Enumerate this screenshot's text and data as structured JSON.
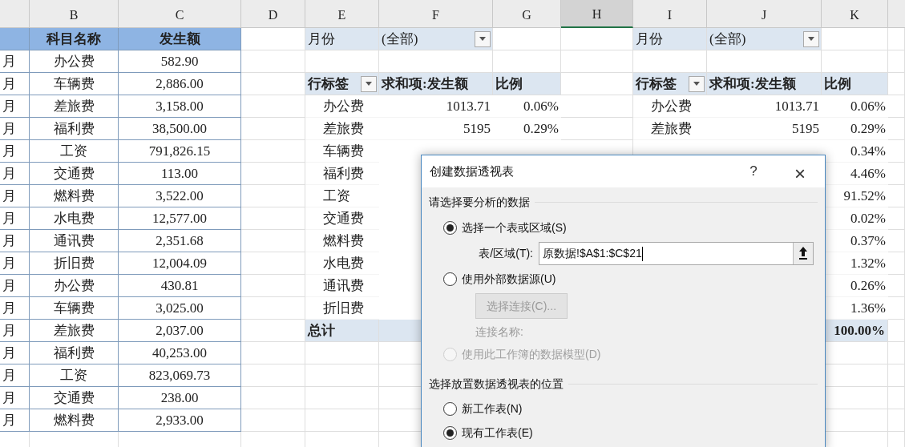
{
  "columns": [
    {
      "label": "B",
      "selected": false
    },
    {
      "label": "C",
      "selected": false
    },
    {
      "label": "D",
      "selected": false
    },
    {
      "label": "E",
      "selected": false
    },
    {
      "label": "F",
      "selected": false
    },
    {
      "label": "G",
      "selected": false
    },
    {
      "label": "H",
      "selected": true
    },
    {
      "label": "I",
      "selected": false
    },
    {
      "label": "J",
      "selected": false
    },
    {
      "label": "K",
      "selected": false
    }
  ],
  "source_table": {
    "columns": [
      "科目名称",
      "发生额"
    ],
    "rows": [
      {
        "column_1": "月",
        "item": "办公费",
        "amount": "582.90"
      },
      {
        "column_1": "月",
        "item": "车辆费",
        "amount": "2,886.00"
      },
      {
        "column_1": "月",
        "item": "差旅费",
        "amount": "3,158.00"
      },
      {
        "column_1": "月",
        "item": "福利费",
        "amount": "38,500.00"
      },
      {
        "column_1": "月",
        "item": "工资",
        "amount": "791,826.15"
      },
      {
        "column_1": "月",
        "item": "交通费",
        "amount": "113.00"
      },
      {
        "column_1": "月",
        "item": "燃料费",
        "amount": "3,522.00"
      },
      {
        "column_1": "月",
        "item": "水电费",
        "amount": "12,577.00"
      },
      {
        "column_1": "月",
        "item": "通讯费",
        "amount": "2,351.68"
      },
      {
        "column_1": "月",
        "item": "折旧费",
        "amount": "12,004.09"
      },
      {
        "column_1": "月",
        "item": "办公费",
        "amount": "430.81"
      },
      {
        "column_1": "月",
        "item": "车辆费",
        "amount": "3,025.00"
      },
      {
        "column_1": "月",
        "item": "差旅费",
        "amount": "2,037.00"
      },
      {
        "column_1": "月",
        "item": "福利费",
        "amount": "40,253.00"
      },
      {
        "column_1": "月",
        "item": "工资",
        "amount": "823,069.73"
      },
      {
        "column_1": "月",
        "item": "交通费",
        "amount": "238.00"
      },
      {
        "column_1": "月",
        "item": "燃料费",
        "amount": "2,933.00"
      }
    ]
  },
  "pivot_tables": [
    {
      "filter": {
        "label": "月份",
        "value": "(全部)"
      },
      "headers": [
        "行标签",
        "求和项:发生额",
        "比例"
      ],
      "rows": [
        {
          "label": "办公费",
          "sum": "1013.71",
          "ratio": "0.06%"
        },
        {
          "label": "差旅费",
          "sum": "5195",
          "ratio": "0.29%"
        },
        {
          "label": "车辆费"
        },
        {
          "label": "福利费"
        },
        {
          "label": "工资"
        },
        {
          "label": "交通费"
        },
        {
          "label": "燃料费"
        },
        {
          "label": "水电费"
        },
        {
          "label": "通讯费"
        },
        {
          "label": "折旧费"
        }
      ],
      "total": {
        "label": "总计"
      }
    },
    {
      "filter": {
        "label": "月份",
        "value": "(全部)"
      },
      "headers": [
        "行标签",
        "求和项:发生额",
        "比例"
      ],
      "rows": [
        {
          "label": "办公费",
          "sum": "1013.71",
          "ratio": "0.06%"
        },
        {
          "label": "差旅费",
          "sum": "5195",
          "ratio": "0.29%"
        },
        {
          "ratio": "0.34%"
        },
        {
          "ratio": "4.46%"
        },
        {
          "ratio": "91.52%"
        },
        {
          "ratio": "0.02%"
        },
        {
          "ratio": "0.37%"
        },
        {
          "ratio": "1.32%"
        },
        {
          "ratio": "0.26%"
        },
        {
          "ratio": "1.36%"
        }
      ],
      "total": {
        "ratio": "100.00%"
      }
    }
  ],
  "dialog": {
    "title": "创建数据透视表",
    "help": "?",
    "close": "×",
    "sections": [
      {
        "label": "请选择要分析的数据",
        "items": [
          {
            "kind": "radio",
            "label": "选择一个表或区域(S)",
            "selected": true,
            "disabled": false
          },
          {
            "kind": "field",
            "label": "表/区域(T):",
            "value": "原数据!$A$1:$C$21"
          },
          {
            "kind": "radio",
            "label": "使用外部数据源(U)",
            "selected": false,
            "disabled": false
          },
          {
            "kind": "button",
            "label": "选择连接(C)...",
            "disabled": true
          },
          {
            "kind": "note",
            "label": "连接名称:",
            "disabled": true
          },
          {
            "kind": "radio",
            "label": "使用此工作簿的数据模型(D)",
            "selected": false,
            "disabled": true
          }
        ]
      },
      {
        "label": "选择放置数据透视表的位置",
        "items": [
          {
            "kind": "radio",
            "label": "新工作表(N)",
            "selected": false,
            "disabled": false
          },
          {
            "kind": "radio",
            "label": "现有工作表(E)",
            "selected": true,
            "disabled": false
          }
        ]
      }
    ]
  }
}
